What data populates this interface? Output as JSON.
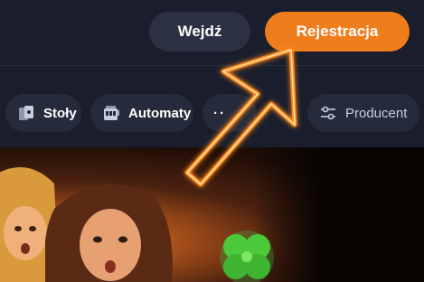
{
  "header": {
    "login_label": "Wejdź",
    "register_label": "Rejestracja"
  },
  "filters": {
    "items": [
      {
        "label": "Stoły",
        "icon": "cards-icon"
      },
      {
        "label": "Automaty",
        "icon": "slot-machine-icon"
      },
      {
        "label": "··",
        "icon": "more-icon"
      },
      {
        "label": "Producent",
        "icon": "sliders-icon"
      }
    ]
  },
  "colors": {
    "accent": "#f07d1c",
    "background": "#1a1e2c",
    "chip": "#262b3b",
    "arrow_glow": "#ff8a1e"
  }
}
